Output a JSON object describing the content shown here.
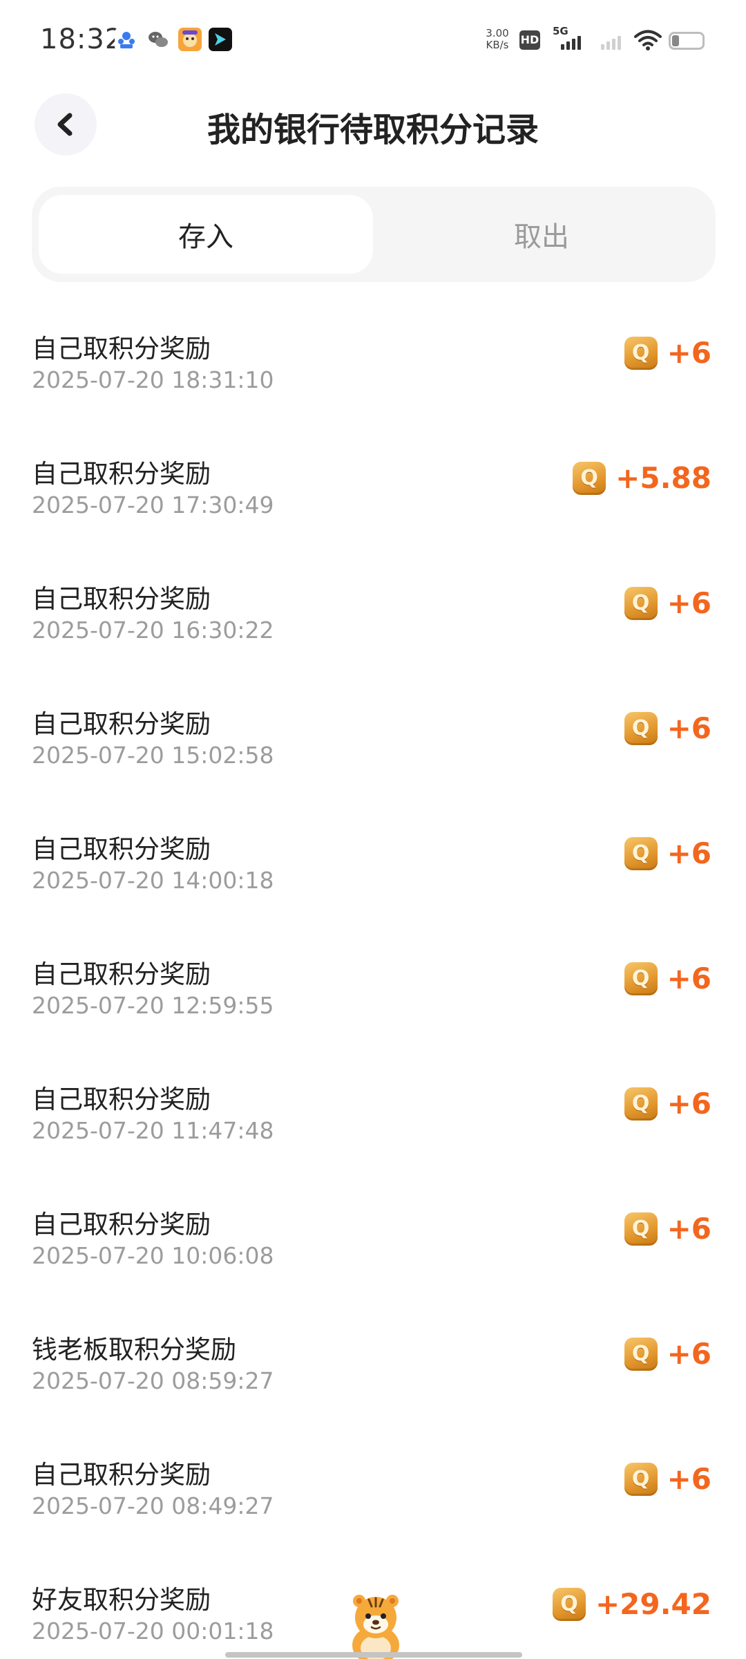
{
  "status_bar": {
    "time": "18:32",
    "net_speed_value": "3.00",
    "net_speed_unit": "KB/s",
    "hd_badge": "HD",
    "network_type": "5G"
  },
  "header": {
    "title": "我的银行待取积分记录"
  },
  "tabs": [
    {
      "label": "存入",
      "active": true
    },
    {
      "label": "取出",
      "active": false
    }
  ],
  "records": [
    {
      "title": "自己取积分奖励",
      "time": "2025-07-20 18:31:10",
      "amount": "+6"
    },
    {
      "title": "自己取积分奖励",
      "time": "2025-07-20 17:30:49",
      "amount": "+5.88"
    },
    {
      "title": "自己取积分奖励",
      "time": "2025-07-20 16:30:22",
      "amount": "+6"
    },
    {
      "title": "自己取积分奖励",
      "time": "2025-07-20 15:02:58",
      "amount": "+6"
    },
    {
      "title": "自己取积分奖励",
      "time": "2025-07-20 14:00:18",
      "amount": "+6"
    },
    {
      "title": "自己取积分奖励",
      "time": "2025-07-20 12:59:55",
      "amount": "+6"
    },
    {
      "title": "自己取积分奖励",
      "time": "2025-07-20 11:47:48",
      "amount": "+6"
    },
    {
      "title": "自己取积分奖励",
      "time": "2025-07-20 10:06:08",
      "amount": "+6"
    },
    {
      "title": "钱老板取积分奖励",
      "time": "2025-07-20 08:59:27",
      "amount": "+6"
    },
    {
      "title": "自己取积分奖励",
      "time": "2025-07-20 08:49:27",
      "amount": "+6"
    },
    {
      "title": "好友取积分奖励",
      "time": "2025-07-20 00:01:18",
      "amount": "+29.42"
    }
  ],
  "coin_icon_letter": "Q",
  "colors": {
    "amount": "#f3661e",
    "coin": "#e2962c",
    "timestamp": "#9c9c9c",
    "tab_inactive": "#9a9a9a"
  }
}
